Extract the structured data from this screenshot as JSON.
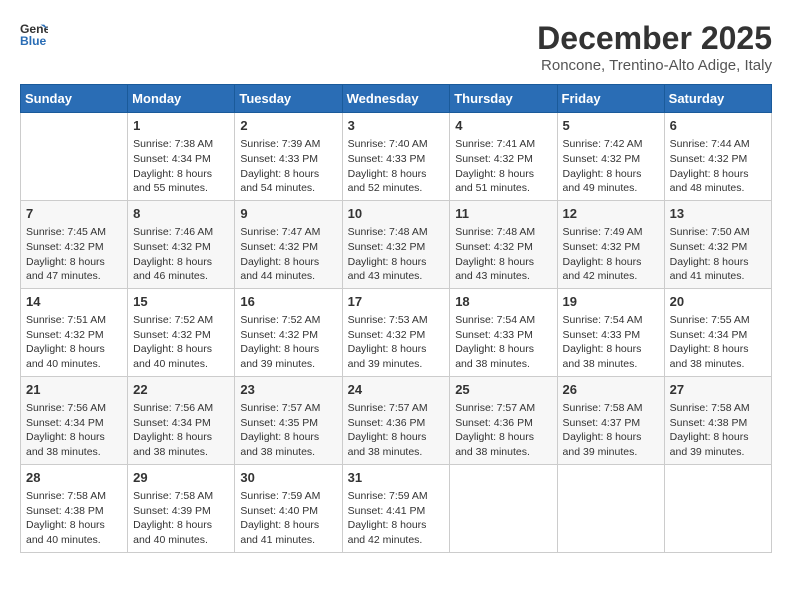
{
  "header": {
    "logo_line1": "General",
    "logo_line2": "Blue",
    "month_title": "December 2025",
    "subtitle": "Roncone, Trentino-Alto Adige, Italy"
  },
  "weekdays": [
    "Sunday",
    "Monday",
    "Tuesday",
    "Wednesday",
    "Thursday",
    "Friday",
    "Saturday"
  ],
  "weeks": [
    [
      {
        "day": "",
        "info": ""
      },
      {
        "day": "1",
        "info": "Sunrise: 7:38 AM\nSunset: 4:34 PM\nDaylight: 8 hours\nand 55 minutes."
      },
      {
        "day": "2",
        "info": "Sunrise: 7:39 AM\nSunset: 4:33 PM\nDaylight: 8 hours\nand 54 minutes."
      },
      {
        "day": "3",
        "info": "Sunrise: 7:40 AM\nSunset: 4:33 PM\nDaylight: 8 hours\nand 52 minutes."
      },
      {
        "day": "4",
        "info": "Sunrise: 7:41 AM\nSunset: 4:32 PM\nDaylight: 8 hours\nand 51 minutes."
      },
      {
        "day": "5",
        "info": "Sunrise: 7:42 AM\nSunset: 4:32 PM\nDaylight: 8 hours\nand 49 minutes."
      },
      {
        "day": "6",
        "info": "Sunrise: 7:44 AM\nSunset: 4:32 PM\nDaylight: 8 hours\nand 48 minutes."
      }
    ],
    [
      {
        "day": "7",
        "info": "Sunrise: 7:45 AM\nSunset: 4:32 PM\nDaylight: 8 hours\nand 47 minutes."
      },
      {
        "day": "8",
        "info": "Sunrise: 7:46 AM\nSunset: 4:32 PM\nDaylight: 8 hours\nand 46 minutes."
      },
      {
        "day": "9",
        "info": "Sunrise: 7:47 AM\nSunset: 4:32 PM\nDaylight: 8 hours\nand 44 minutes."
      },
      {
        "day": "10",
        "info": "Sunrise: 7:48 AM\nSunset: 4:32 PM\nDaylight: 8 hours\nand 43 minutes."
      },
      {
        "day": "11",
        "info": "Sunrise: 7:48 AM\nSunset: 4:32 PM\nDaylight: 8 hours\nand 43 minutes."
      },
      {
        "day": "12",
        "info": "Sunrise: 7:49 AM\nSunset: 4:32 PM\nDaylight: 8 hours\nand 42 minutes."
      },
      {
        "day": "13",
        "info": "Sunrise: 7:50 AM\nSunset: 4:32 PM\nDaylight: 8 hours\nand 41 minutes."
      }
    ],
    [
      {
        "day": "14",
        "info": "Sunrise: 7:51 AM\nSunset: 4:32 PM\nDaylight: 8 hours\nand 40 minutes."
      },
      {
        "day": "15",
        "info": "Sunrise: 7:52 AM\nSunset: 4:32 PM\nDaylight: 8 hours\nand 40 minutes."
      },
      {
        "day": "16",
        "info": "Sunrise: 7:52 AM\nSunset: 4:32 PM\nDaylight: 8 hours\nand 39 minutes."
      },
      {
        "day": "17",
        "info": "Sunrise: 7:53 AM\nSunset: 4:32 PM\nDaylight: 8 hours\nand 39 minutes."
      },
      {
        "day": "18",
        "info": "Sunrise: 7:54 AM\nSunset: 4:33 PM\nDaylight: 8 hours\nand 38 minutes."
      },
      {
        "day": "19",
        "info": "Sunrise: 7:54 AM\nSunset: 4:33 PM\nDaylight: 8 hours\nand 38 minutes."
      },
      {
        "day": "20",
        "info": "Sunrise: 7:55 AM\nSunset: 4:34 PM\nDaylight: 8 hours\nand 38 minutes."
      }
    ],
    [
      {
        "day": "21",
        "info": "Sunrise: 7:56 AM\nSunset: 4:34 PM\nDaylight: 8 hours\nand 38 minutes."
      },
      {
        "day": "22",
        "info": "Sunrise: 7:56 AM\nSunset: 4:34 PM\nDaylight: 8 hours\nand 38 minutes."
      },
      {
        "day": "23",
        "info": "Sunrise: 7:57 AM\nSunset: 4:35 PM\nDaylight: 8 hours\nand 38 minutes."
      },
      {
        "day": "24",
        "info": "Sunrise: 7:57 AM\nSunset: 4:36 PM\nDaylight: 8 hours\nand 38 minutes."
      },
      {
        "day": "25",
        "info": "Sunrise: 7:57 AM\nSunset: 4:36 PM\nDaylight: 8 hours\nand 38 minutes."
      },
      {
        "day": "26",
        "info": "Sunrise: 7:58 AM\nSunset: 4:37 PM\nDaylight: 8 hours\nand 39 minutes."
      },
      {
        "day": "27",
        "info": "Sunrise: 7:58 AM\nSunset: 4:38 PM\nDaylight: 8 hours\nand 39 minutes."
      }
    ],
    [
      {
        "day": "28",
        "info": "Sunrise: 7:58 AM\nSunset: 4:38 PM\nDaylight: 8 hours\nand 40 minutes."
      },
      {
        "day": "29",
        "info": "Sunrise: 7:58 AM\nSunset: 4:39 PM\nDaylight: 8 hours\nand 40 minutes."
      },
      {
        "day": "30",
        "info": "Sunrise: 7:59 AM\nSunset: 4:40 PM\nDaylight: 8 hours\nand 41 minutes."
      },
      {
        "day": "31",
        "info": "Sunrise: 7:59 AM\nSunset: 4:41 PM\nDaylight: 8 hours\nand 42 minutes."
      },
      {
        "day": "",
        "info": ""
      },
      {
        "day": "",
        "info": ""
      },
      {
        "day": "",
        "info": ""
      }
    ]
  ]
}
